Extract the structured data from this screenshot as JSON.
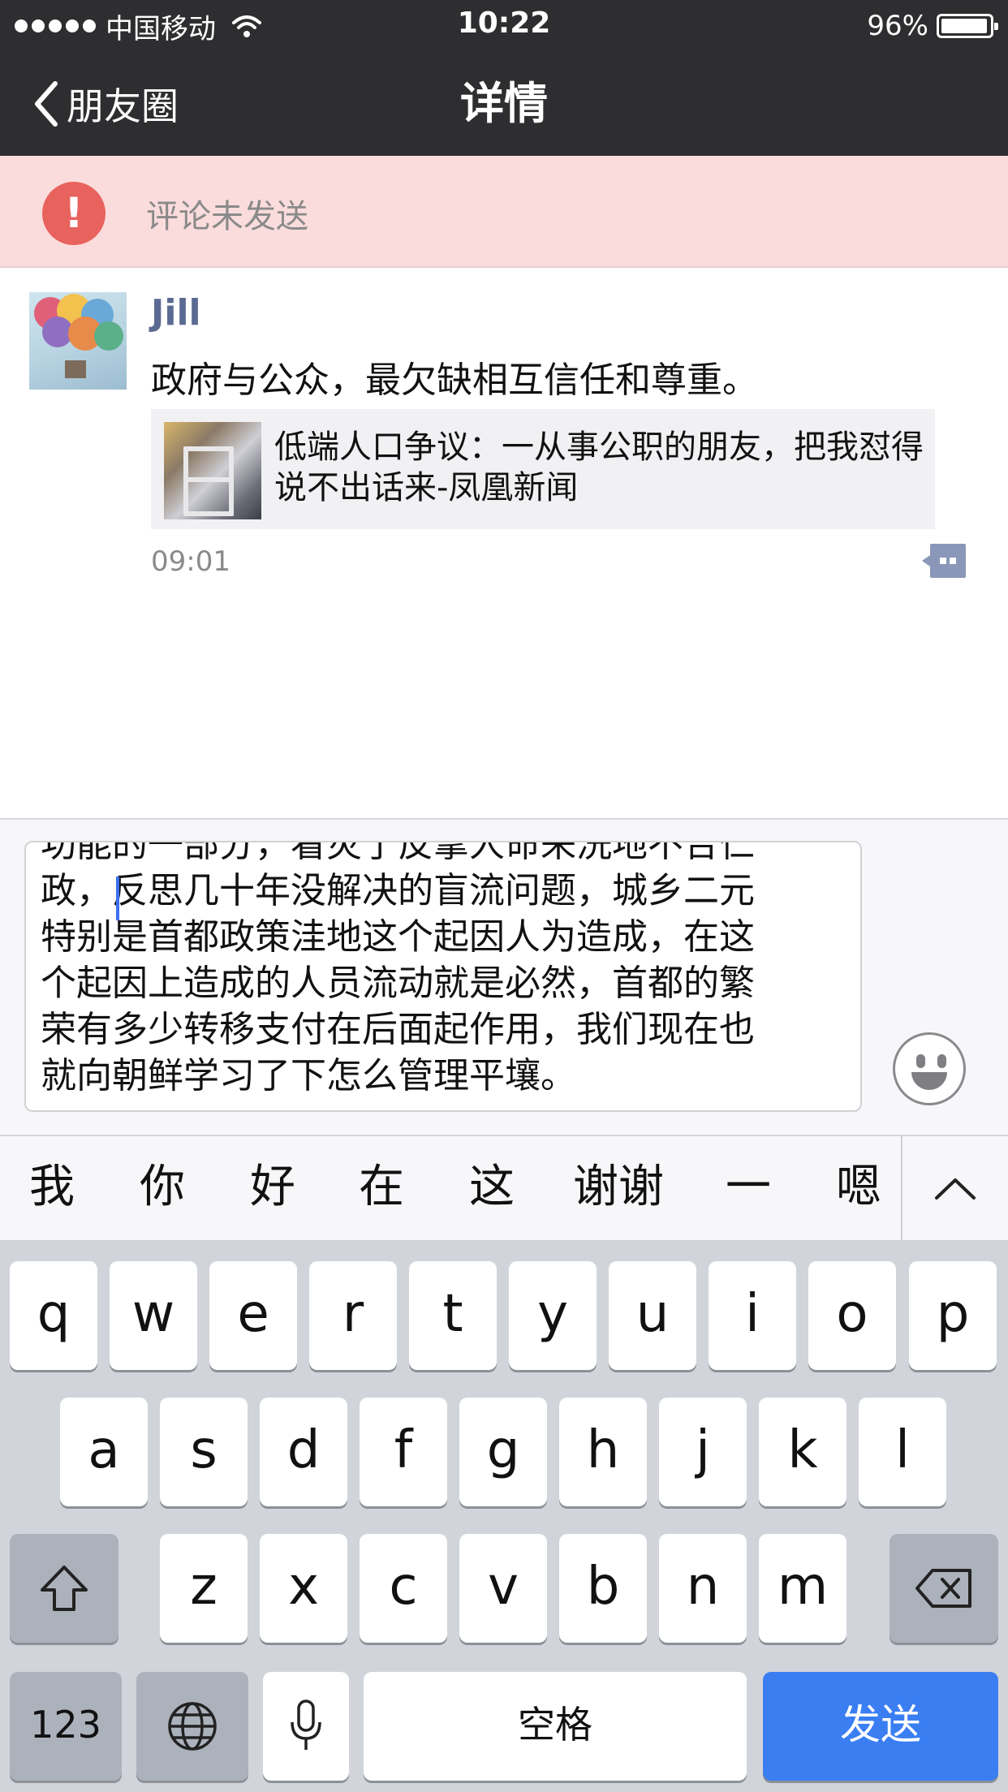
{
  "status_bar": {
    "carrier": "中国移动",
    "time": "10:22",
    "battery": "96%"
  },
  "nav": {
    "back_label": "朋友圈",
    "title": "详情"
  },
  "error_banner": {
    "message": "评论未发送",
    "icon": "exclamation-icon",
    "color": "#e8625e"
  },
  "post": {
    "author": "Jill",
    "text": "政府与公众，最欠缺相互信任和尊重。",
    "link": {
      "title": "低端人口争议：一从事公职的朋友，把我怼得说不出话来-凤凰新闻"
    },
    "time": "09:01"
  },
  "comment_input": {
    "lines": [
      "功能的一部分，看灾了反拿人命来洗地不合仁",
      "政，反思几十年没解决的盲流问题，城乡二元",
      "特别是首都政策洼地这个起因人为造成，在这",
      "个起因上造成的人员流动就是必然，首都的繁",
      "荣有多少转移支付在后面起作用，我们现在也",
      "就向朝鲜学习了下怎么管理平壤。"
    ]
  },
  "candidates": [
    "我",
    "你",
    "好",
    "在",
    "这",
    "谢谢",
    "一",
    "嗯"
  ],
  "keyboard": {
    "row1": [
      "q",
      "w",
      "e",
      "r",
      "t",
      "y",
      "u",
      "i",
      "o",
      "p"
    ],
    "row2": [
      "a",
      "s",
      "d",
      "f",
      "g",
      "h",
      "j",
      "k",
      "l"
    ],
    "row3": [
      "z",
      "x",
      "c",
      "v",
      "b",
      "n",
      "m"
    ],
    "numbers_label": "123",
    "space_label": "空格",
    "send_label": "发送",
    "send_color": "#3a7ef2"
  }
}
